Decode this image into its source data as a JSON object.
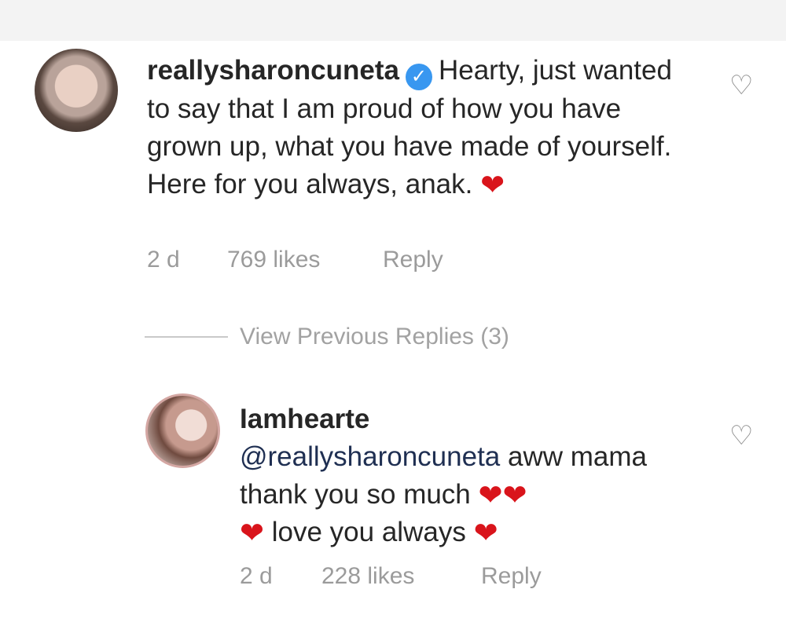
{
  "comments": {
    "main": {
      "username": "reallysharoncuneta",
      "verified_label": "✓",
      "body": "Hearty, just wanted to say that I am proud of how you have grown up, what you have made of yourself. Here for you always, anak.",
      "emoji": "❤",
      "time": "2 d",
      "likes": "769 likes",
      "reply": "Reply"
    },
    "replies_link": "View Previous Replies (3)",
    "reply": {
      "username": "Iamhearte",
      "mention": "@reallysharoncuneta",
      "line_1": "aww mama thank you so much",
      "emoji_1": "❤❤",
      "emoji_2": "❤",
      "line_2": "love you always",
      "emoji_3": "❤",
      "time": "2 d",
      "likes": "228 likes",
      "reply": "Reply"
    }
  },
  "icons": {
    "like": "heart-outline-icon",
    "verified": "verified-badge-icon"
  },
  "colors": {
    "text": "#262626",
    "muted": "#9b9b9b",
    "verified": "#3897f0",
    "heart": "#d9141b"
  }
}
